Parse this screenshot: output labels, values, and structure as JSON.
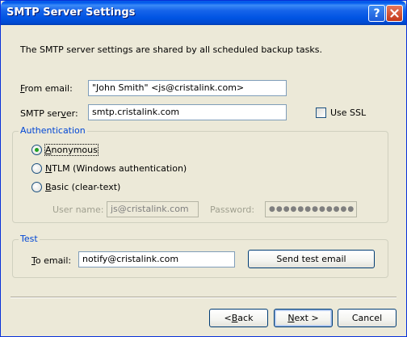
{
  "window": {
    "title": "SMTP Server Settings",
    "help_glyph": "?",
    "colors": {
      "titlebar": "#0054e3",
      "face": "#ece9d8",
      "group_label": "#0046d5",
      "radio_dot": "#21a121"
    }
  },
  "intro_text": "The SMTP server settings are shared by all scheduled backup tasks.",
  "from_email": {
    "label_key": "F",
    "label_rest": "rom email:",
    "value": "\"John Smith\" <js@cristalink.com>"
  },
  "smtp_server": {
    "label_pre": "SMTP ser",
    "label_key": "v",
    "label_post": "er:",
    "value": "smtp.cristalink.com"
  },
  "use_ssl": {
    "label": "Use SSL",
    "checked": false
  },
  "authentication": {
    "group_label": "Authentication",
    "options": [
      {
        "key": "A",
        "rest": "nonymous",
        "selected": true
      },
      {
        "key": "N",
        "rest": "TLM (Windows authentication)",
        "selected": false
      },
      {
        "key": "B",
        "rest": "asic (clear-text)",
        "selected": false
      }
    ],
    "username": {
      "label": "User name:",
      "value": "js@cristalink.com"
    },
    "password": {
      "label": "Password:",
      "value": "●●●●●●●●●●●●"
    }
  },
  "test": {
    "group_label": "Test",
    "to_email": {
      "label_key": "T",
      "label_rest": "o email:",
      "value": "notify@cristalink.com"
    },
    "send_button": "Send test email"
  },
  "buttons": {
    "back": {
      "pre": "< ",
      "key": "B",
      "rest": "ack"
    },
    "next": {
      "key": "N",
      "rest": "ext >"
    },
    "cancel": "Cancel"
  }
}
